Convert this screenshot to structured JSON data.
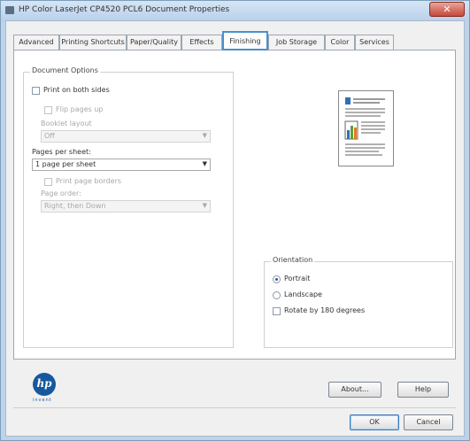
{
  "window": {
    "title": "HP Color LaserJet CP4520 PCL6 Document Properties",
    "close_glyph": "✕"
  },
  "tabs": [
    {
      "label": "Advanced",
      "active": false
    },
    {
      "label": "Printing Shortcuts",
      "active": false
    },
    {
      "label": "Paper/Quality",
      "active": false
    },
    {
      "label": "Effects",
      "active": false
    },
    {
      "label": "Finishing",
      "active": true
    },
    {
      "label": "Job Storage",
      "active": false
    },
    {
      "label": "Color",
      "active": false
    },
    {
      "label": "Services",
      "active": false
    }
  ],
  "document_options": {
    "legend": "Document Options",
    "print_both_sides": {
      "label": "Print on both sides",
      "checked": false
    },
    "flip_pages_up": {
      "label": "Flip pages up",
      "checked": false,
      "enabled": false
    },
    "booklet_layout": {
      "label": "Booklet layout",
      "value": "Off",
      "enabled": false
    },
    "pages_per_sheet": {
      "label": "Pages per sheet:",
      "value": "1 page per sheet"
    },
    "print_page_borders": {
      "label": "Print page borders",
      "checked": false,
      "enabled": false
    },
    "page_order": {
      "label": "Page order:",
      "value": "Right, then Down",
      "enabled": false
    }
  },
  "orientation": {
    "legend": "Orientation",
    "portrait": {
      "label": "Portrait",
      "checked": true
    },
    "landscape": {
      "label": "Landscape",
      "checked": false
    },
    "rotate": {
      "label": "Rotate by 180 degrees",
      "checked": false
    }
  },
  "buttons": {
    "about": "About...",
    "help": "Help",
    "ok": "OK",
    "cancel": "Cancel"
  },
  "logo": {
    "text": "hp",
    "tagline": "invent"
  },
  "icons": {
    "title": "printer-icon",
    "dropdown": "chevron-down-icon",
    "preview": "page-preview-icon"
  },
  "colors": {
    "active_tab_border": "#4b8fd0",
    "hp_blue": "#16589e",
    "preview_bar_blue": "#2f6fb8",
    "preview_bar_green": "#5aa03a",
    "preview_bar_orange": "#e07a1f"
  }
}
